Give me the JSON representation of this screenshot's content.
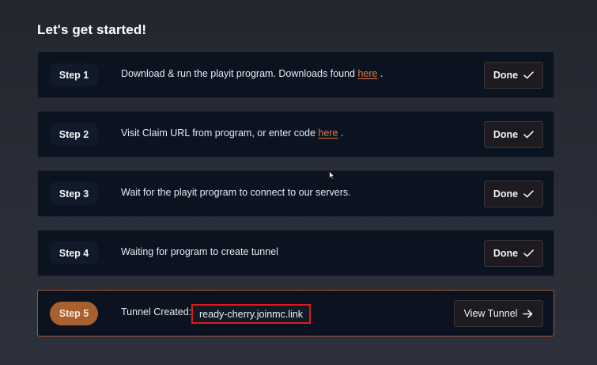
{
  "page": {
    "heading": "Let's get started!"
  },
  "steps": [
    {
      "badge": "Step 1",
      "text_before": "Download & run the playit program. Downloads found ",
      "link": "here",
      "text_after": " .",
      "button_label": "Done",
      "button_icon": "check-icon"
    },
    {
      "badge": "Step 2",
      "text_before": "Visit Claim URL from program, or enter code ",
      "link": "here",
      "text_after": " .",
      "button_label": "Done",
      "button_icon": "check-icon"
    },
    {
      "badge": "Step 3",
      "text": "Wait for the playit program to connect to our servers.",
      "button_label": "Done",
      "button_icon": "check-icon"
    },
    {
      "badge": "Step 4",
      "text": "Waiting for program to create tunnel",
      "button_label": "Done",
      "button_icon": "check-icon"
    },
    {
      "badge": "Step 5",
      "text": "Tunnel Created:",
      "tunnel_address": "ready-cherry.joinmc.link",
      "button_label": "View Tunnel",
      "button_icon": "arrow-right-icon"
    }
  ],
  "colors": {
    "background": "#262932",
    "row_background": "#0b1220",
    "active_border": "#a25a31",
    "active_badge": "#a8602f",
    "link": "#e07a45",
    "highlight_box": "#e0191b"
  }
}
